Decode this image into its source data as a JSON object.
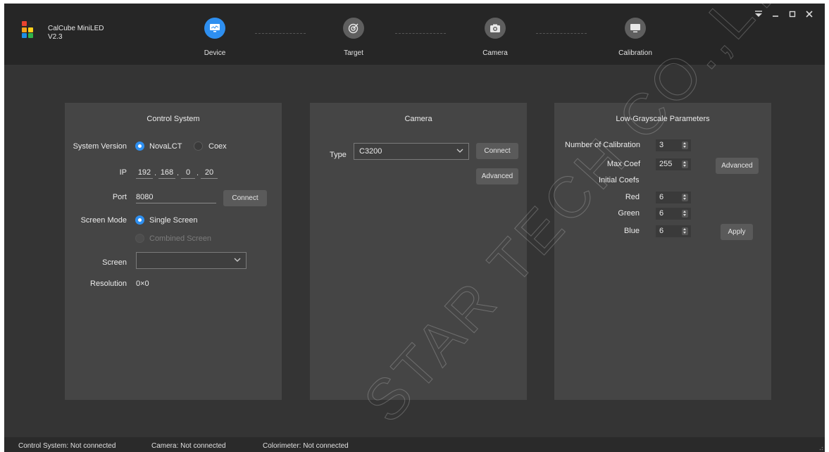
{
  "app": {
    "name": "CalCube MiniLED",
    "version": "V2.3"
  },
  "steps": [
    {
      "label": "Device",
      "active": true,
      "icon": "monitor-chart-icon"
    },
    {
      "label": "Target",
      "active": false,
      "icon": "target-icon"
    },
    {
      "label": "Camera",
      "active": false,
      "icon": "camera-icon"
    },
    {
      "label": "Calibration",
      "active": false,
      "icon": "display-icon"
    }
  ],
  "window_controls": [
    "dropdown-icon",
    "minimize-icon",
    "maximize-icon",
    "close-icon"
  ],
  "control_system": {
    "title": "Control System",
    "system_version_label": "System Version",
    "options": [
      "NovaLCT",
      "Coex"
    ],
    "selected": "NovaLCT",
    "ip_label": "IP",
    "ip": [
      "192",
      "168",
      "0",
      "20"
    ],
    "port_label": "Port",
    "port": "8080",
    "connect_label": "Connect",
    "screen_mode_label": "Screen Mode",
    "screen_modes": [
      "Single Screen",
      "Combined Screen"
    ],
    "screen_label": "Screen",
    "screen_value": "",
    "resolution_label": "Resolution",
    "resolution": "0×0"
  },
  "camera": {
    "title": "Camera",
    "type_label": "Type",
    "type_value": "C3200",
    "connect_label": "Connect",
    "advanced_label": "Advanced"
  },
  "low_grayscale": {
    "title": "Low-Grayscale Parameters",
    "num_calibration_label": "Number of Calibration",
    "num_calibration": "3",
    "max_coef_label": "Max Coef",
    "max_coef": "255",
    "advanced_label": "Advanced",
    "initial_coefs_label": "Initial Coefs",
    "red_label": "Red",
    "red": "6",
    "green_label": "Green",
    "green": "6",
    "blue_label": "Blue",
    "blue": "6",
    "apply_label": "Apply"
  },
  "status": {
    "control_system": "Control System: Not connected",
    "camera": "Camera: Not connected",
    "colorimeter": "Colorimeter: Not connected"
  },
  "watermark": "STAR TECH CO.,LTL",
  "colors": {
    "accent": "#2e8ff0",
    "background": "#343434",
    "panel": "#454545",
    "header": "#262626"
  }
}
